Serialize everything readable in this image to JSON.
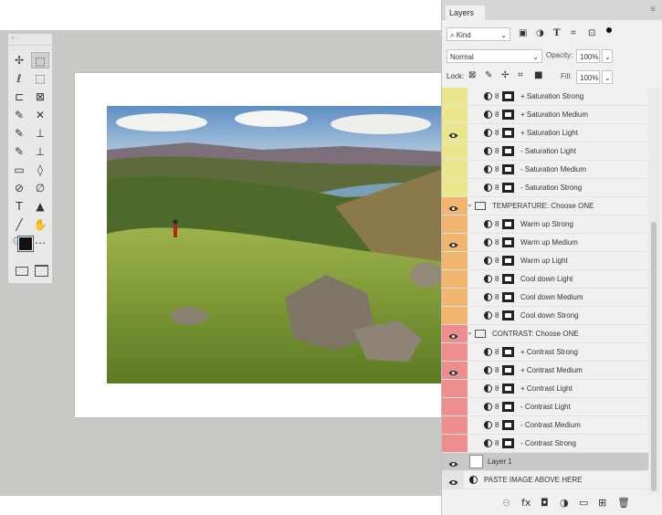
{
  "panel": {
    "tab_label": "Layers",
    "menu_glyph": "≡",
    "filter": {
      "value": "Kind",
      "icon": "search-icon"
    },
    "blend_mode": "Normal",
    "opacity_label": "Opacity:",
    "opacity_value": "100%",
    "lock_label": "Lock:",
    "fill_label": "Fill:",
    "fill_value": "100%"
  },
  "layers": [
    {
      "name": "+ Saturation Strong",
      "color": "#e9e68c",
      "visible": false,
      "type": "adjust"
    },
    {
      "name": "+ Saturation Medium",
      "color": "#e9e68c",
      "visible": false,
      "type": "adjust"
    },
    {
      "name": "+ Saturation Light",
      "color": "#e9e68c",
      "visible": true,
      "type": "adjust"
    },
    {
      "name": "- Saturation Light",
      "color": "#e9e68c",
      "visible": false,
      "type": "adjust"
    },
    {
      "name": "- Saturation Medium",
      "color": "#e9e68c",
      "visible": false,
      "type": "adjust"
    },
    {
      "name": "- Saturation Strong",
      "color": "#e9e68c",
      "visible": false,
      "type": "adjust"
    },
    {
      "name": "TEMPERATURE: Choose ONE",
      "color": "#f1b56f",
      "visible": true,
      "type": "group"
    },
    {
      "name": "Warm up Strong",
      "color": "#f1b56f",
      "visible": false,
      "type": "adjust"
    },
    {
      "name": "Warm up Medium",
      "color": "#f1b56f",
      "visible": true,
      "type": "adjust"
    },
    {
      "name": "Warm up Light",
      "color": "#f1b56f",
      "visible": false,
      "type": "adjust"
    },
    {
      "name": "Cool down Light",
      "color": "#f1b56f",
      "visible": false,
      "type": "adjust"
    },
    {
      "name": "Cool down Medium",
      "color": "#f1b56f",
      "visible": false,
      "type": "adjust"
    },
    {
      "name": "Cool down Strong",
      "color": "#f1b56f",
      "visible": false,
      "type": "adjust"
    },
    {
      "name": "CONTRAST: Choose ONE",
      "color": "#ee8d8d",
      "visible": true,
      "type": "group"
    },
    {
      "name": "+ Contrast Strong",
      "color": "#ee8d8d",
      "visible": false,
      "type": "adjust"
    },
    {
      "name": "+ Contrast Medium",
      "color": "#ee8d8d",
      "visible": true,
      "type": "adjust"
    },
    {
      "name": "+ Contrast Light",
      "color": "#ee8d8d",
      "visible": false,
      "type": "adjust"
    },
    {
      "name": "- Contrast Light",
      "color": "#ee8d8d",
      "visible": false,
      "type": "adjust"
    },
    {
      "name": "- Contrast Medium",
      "color": "#ee8d8d",
      "visible": false,
      "type": "adjust"
    },
    {
      "name": "- Contrast Strong",
      "color": "#ee8d8d",
      "visible": false,
      "type": "adjust"
    },
    {
      "name": "Layer 1",
      "color": "#c8c8c8",
      "visible": true,
      "type": "pixel",
      "selected": true
    },
    {
      "name": "PASTE IMAGE ABOVE HERE",
      "color": "#e4e4e4",
      "visible": true,
      "type": "fill"
    }
  ],
  "bottom_icons": [
    "link-icon",
    "fx-icon",
    "mask-icon",
    "adjustment-icon",
    "group-icon",
    "new-layer-icon",
    "trash-icon"
  ],
  "bottom_glyphs": [
    "⊖",
    "fx",
    "◘",
    "◑",
    "▭",
    "⊞",
    "🗑"
  ],
  "tool_glyphs": [
    "✢",
    "⬚",
    "ℓ",
    "⬚",
    "⊏",
    "⊠",
    "✎",
    "✕",
    "✎",
    "⊥",
    "✎",
    "⊥",
    "▭",
    "◊",
    "⊘",
    "∅",
    "T",
    "▲",
    "╱",
    "✋",
    "🔍",
    "⋯"
  ]
}
